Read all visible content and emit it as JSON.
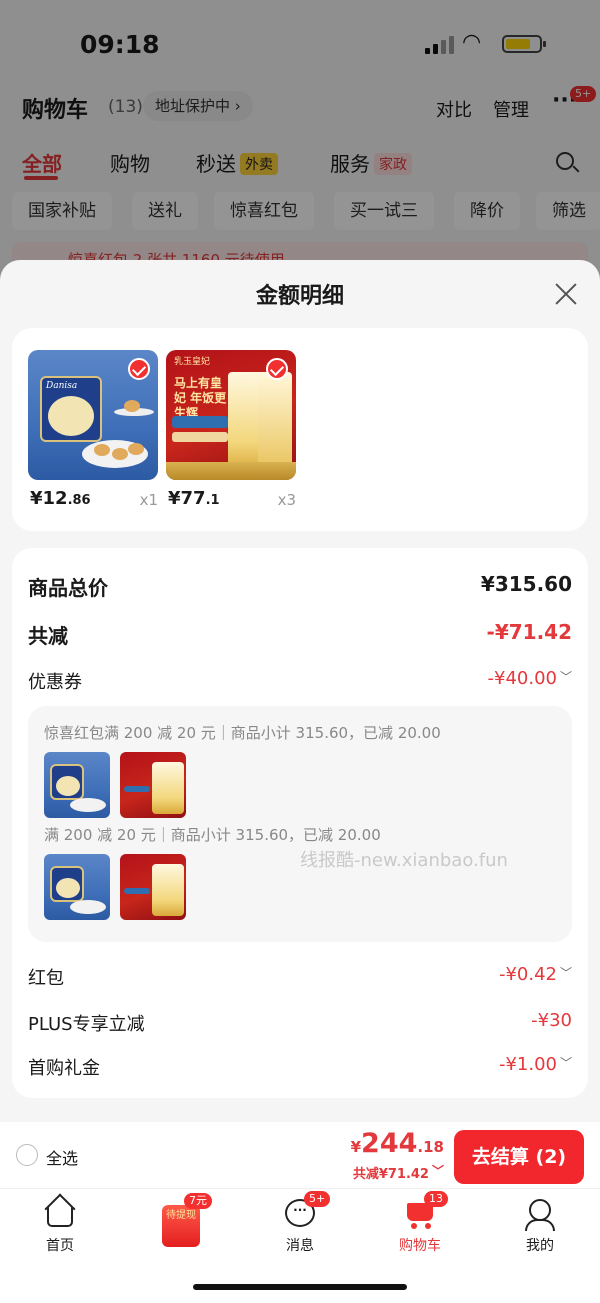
{
  "status_bar": {
    "time": "09:18"
  },
  "cart_header": {
    "title": "购物车",
    "count": "(13)",
    "address_pill": "地址保护中",
    "compare": "对比",
    "manage": "管理",
    "more_badge": "5+"
  },
  "top_tabs": [
    {
      "label": "全部"
    },
    {
      "label": "购物"
    },
    {
      "label": "秒送",
      "tag": "外卖"
    },
    {
      "label": "服务",
      "tag": "家政"
    }
  ],
  "filter_chips": [
    "国家补贴",
    "送礼",
    "惊喜红包",
    "买一试三",
    "降价",
    "筛选"
  ],
  "promo_strip": "惊喜红包 2 张共 1160 元待使用",
  "sheet": {
    "title": "金额明细",
    "products": [
      {
        "price_int": "¥12",
        "price_dec": ".86",
        "qty": "x1"
      },
      {
        "price_int": "¥77",
        "price_dec": ".1",
        "qty": "x3"
      }
    ],
    "cookie_brand": "Danisa",
    "rice_brand": "乳玉皇妃",
    "rice_slogan": "马上有皇妃 年饭更生辉",
    "rows": {
      "total_label": "商品总价",
      "total_value": "¥315.60",
      "reduce_label": "共减",
      "reduce_value": "-¥71.42",
      "coupon_label": "优惠券",
      "coupon_value": "-¥40.00",
      "redpacket_label": "红包",
      "redpacket_value": "-¥0.42",
      "plus_label": "PLUS专享立减",
      "plus_value": "-¥30",
      "firstbuy_label": "首购礼金",
      "firstbuy_value": "-¥1.00"
    },
    "coupon_details": [
      "惊喜红包满 200 减 20 元｜商品小计 315.60，已减 20.00",
      "满 200 减 20 元｜商品小计 315.60，已减 20.00"
    ],
    "watermark": "线报酷-new.xianbao.fun"
  },
  "footer": {
    "select_all": "全选",
    "total_currency": "¥",
    "total_int": "244",
    "total_dec": ".18",
    "saved": "共减¥71.42",
    "checkout": "去结算 (2)"
  },
  "tabbar": {
    "home": "首页",
    "redpack_text": "待提现",
    "redpack_badge": "7元",
    "messages": "消息",
    "messages_badge": "5+",
    "cart": "购物车",
    "cart_badge": "13",
    "me": "我的"
  },
  "colors": {
    "accent": "#e4393c",
    "checkout": "#f2272e"
  }
}
